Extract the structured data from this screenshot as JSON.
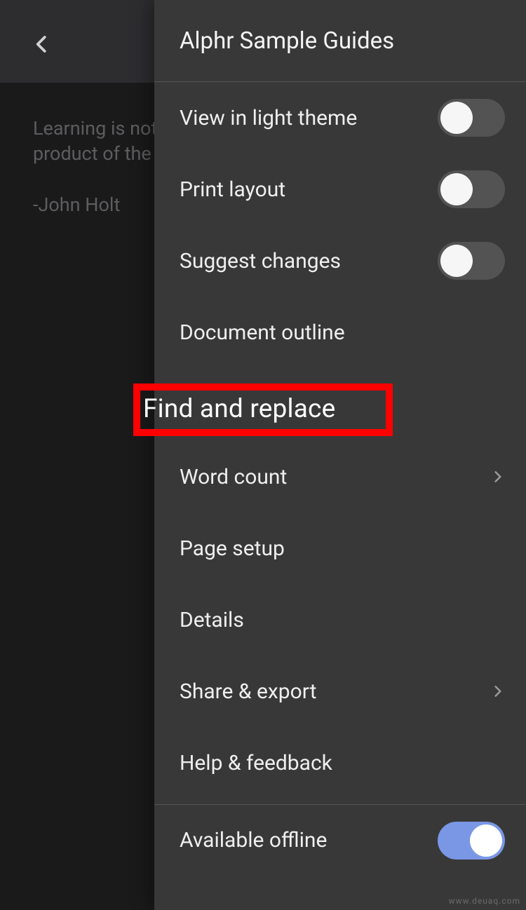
{
  "background": {
    "quote_line1": "Learning is not t",
    "quote_line2": "product of the a",
    "author": "-John Holt"
  },
  "panel": {
    "title": "Alphr Sample Guides"
  },
  "menu": {
    "view_light_theme": "View in light theme",
    "print_layout": "Print layout",
    "suggest_changes": "Suggest changes",
    "document_outline": "Document outline",
    "find_replace": "Find and replace",
    "word_count": "Word count",
    "page_setup": "Page setup",
    "details": "Details",
    "share_export": "Share & export",
    "help_feedback": "Help & feedback",
    "available_offline": "Available offline"
  },
  "toggles": {
    "view_light_theme": false,
    "print_layout": false,
    "suggest_changes": false,
    "available_offline": true
  },
  "watermark": "www.deuaq.com"
}
